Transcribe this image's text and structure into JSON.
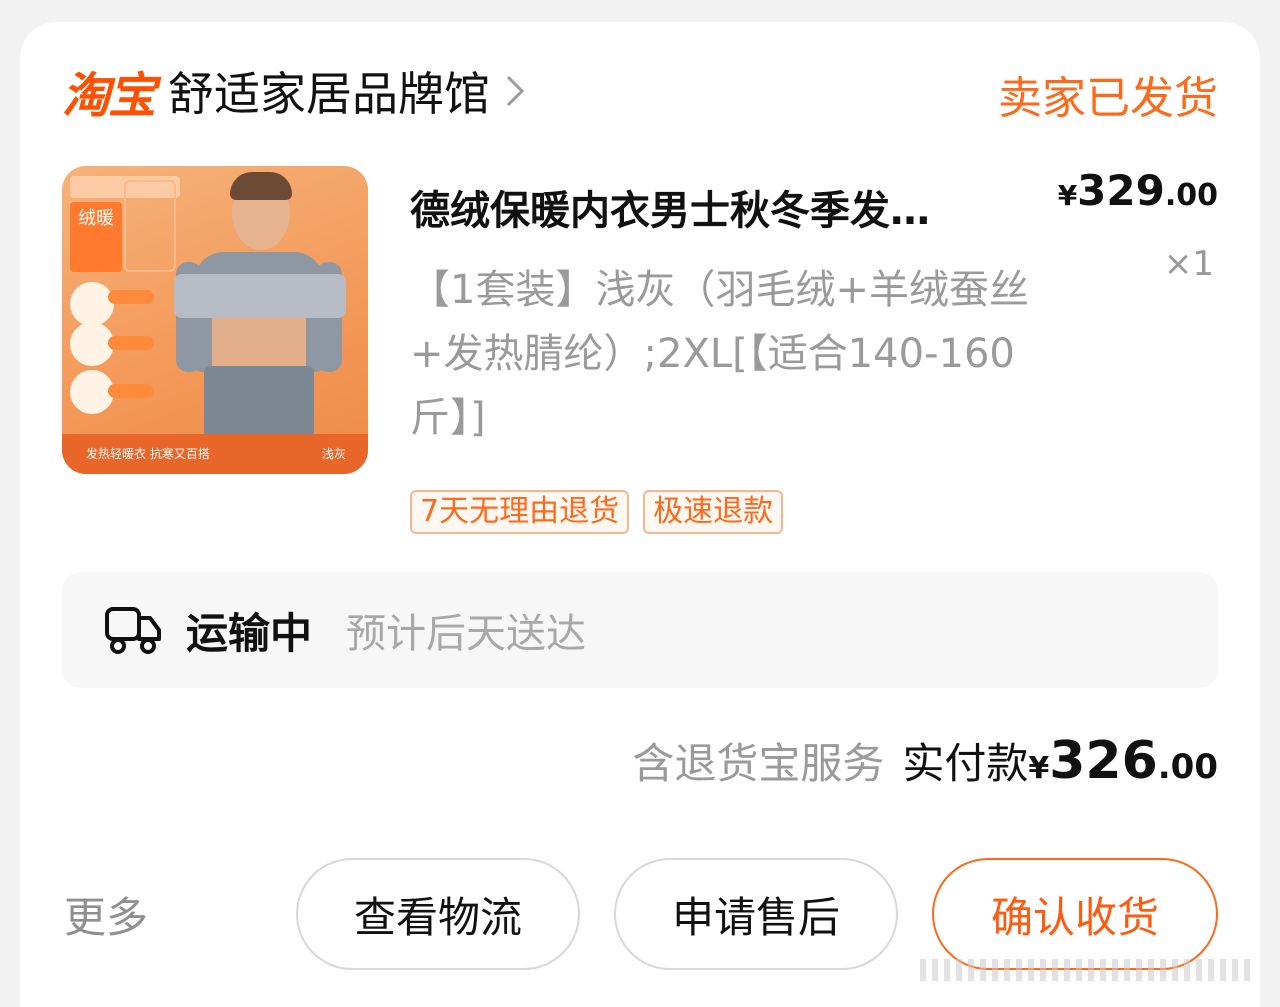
{
  "shop": {
    "logo_text": "淘宝",
    "name": "舒适家居品牌馆",
    "status": "卖家已发货"
  },
  "item": {
    "title": "德绒保暖内衣男士秋冬季发…",
    "price_symbol": "¥",
    "price_int": "329",
    "price_dec": ".00",
    "quantity": "×1",
    "sku": "【1套装】浅灰（羽毛绒+羊绒蚕丝+发热腈纶）;2XL[【适合140-160斤】]",
    "image_badge": "绒暖",
    "image_bottom_left": "发热轻暖衣 抗寒又百搭",
    "image_bottom_right": "浅灰",
    "service_tags": [
      "7天无理由退货",
      "极速退款"
    ]
  },
  "shipping": {
    "icon": "truck-icon",
    "status": "运输中",
    "eta": "预计后天送达"
  },
  "payment": {
    "service": "含退货宝服务",
    "label": "实付款",
    "symbol": "¥",
    "int": "326",
    "dec": ".00"
  },
  "actions": {
    "more": "更多",
    "logistics": "查看物流",
    "after_sale": "申请售后",
    "confirm": "确认收货"
  },
  "colors": {
    "accent": "#ff6a1a",
    "text": "#111111",
    "muted": "#9a9a9a"
  }
}
